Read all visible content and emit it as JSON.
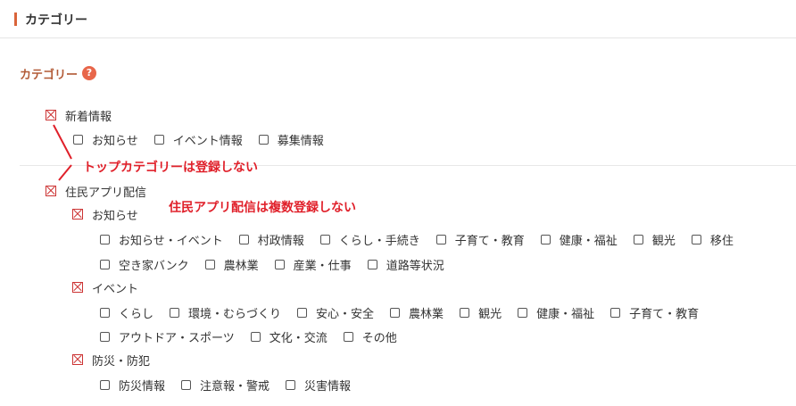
{
  "header": {
    "title": "カテゴリー"
  },
  "field": {
    "label": "カテゴリー",
    "help": "?"
  },
  "annotations": {
    "top_category": "トップカテゴリーは登録しない",
    "multi_reg": "住民アプリ配信は複数登録しない"
  },
  "groups": [
    {
      "label": "新着情報",
      "items": [
        "お知らせ",
        "イベント情報",
        "募集情報"
      ]
    },
    {
      "label": "住民アプリ配信",
      "subgroups": [
        {
          "label": "お知らせ",
          "rows": [
            [
              "お知らせ・イベント",
              "村政情報",
              "くらし・手続き",
              "子育て・教育",
              "健康・福祉",
              "観光",
              "移住"
            ],
            [
              "空き家バンク",
              "農林業",
              "産業・仕事",
              "道路等状況"
            ]
          ]
        },
        {
          "label": "イベント",
          "rows": [
            [
              "くらし",
              "環境・むらづくり",
              "安心・安全",
              "農林業",
              "観光",
              "健康・福祉",
              "子育て・教育"
            ],
            [
              "アウトドア・スポーツ",
              "文化・交流",
              "その他"
            ]
          ]
        },
        {
          "label": "防災・防犯",
          "rows": [
            [
              "防災情報",
              "注意報・警戒",
              "災害情報"
            ]
          ]
        }
      ]
    }
  ]
}
